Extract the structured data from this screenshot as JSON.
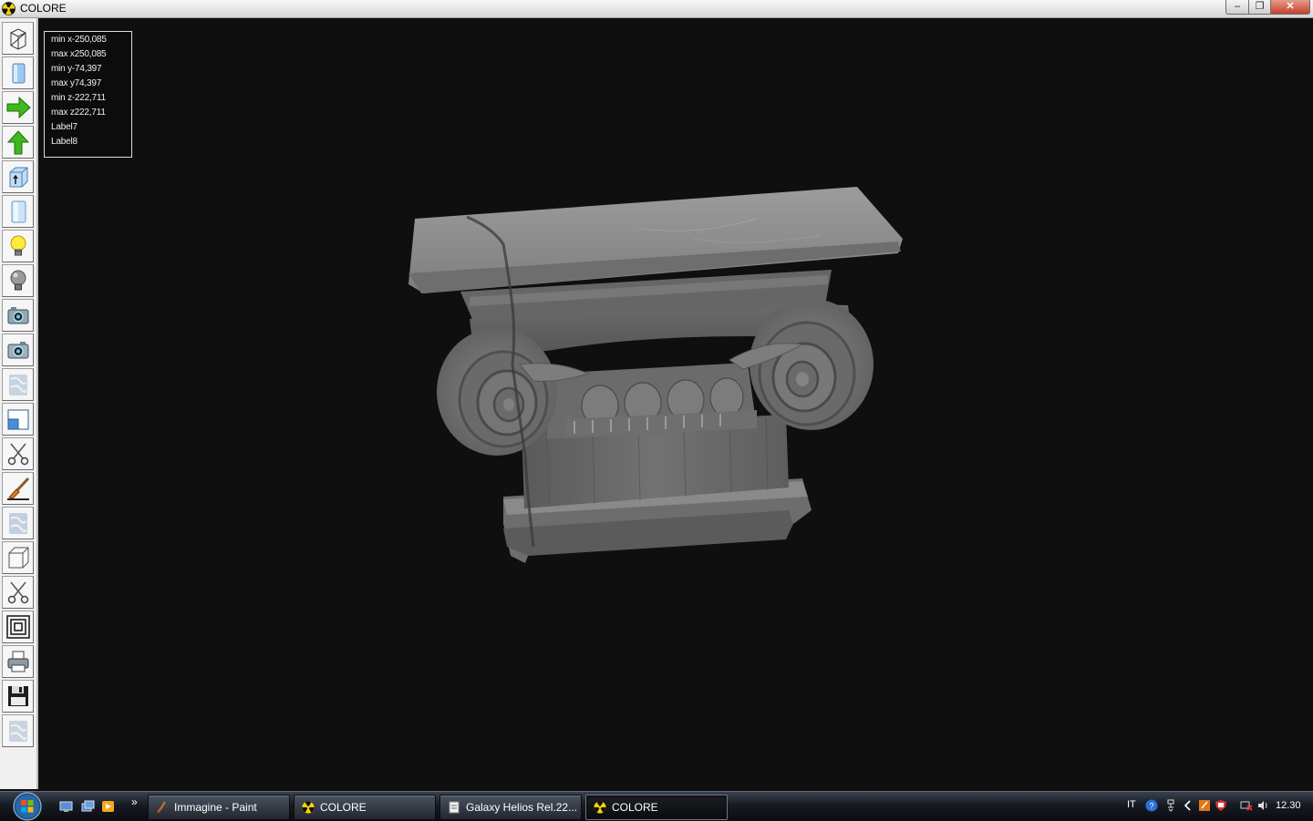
{
  "window": {
    "title": "COLORE",
    "controls": {
      "minimize": "–",
      "maximize": "❐",
      "close": "✕"
    }
  },
  "toolbar": {
    "tools": [
      {
        "icon": "wireframe-box-icon"
      },
      {
        "icon": "solid-block-icon"
      },
      {
        "icon": "arrow-right-green-icon"
      },
      {
        "icon": "arrow-up-green-icon"
      },
      {
        "icon": "extrude-up-icon"
      },
      {
        "icon": "cylinder-block-icon"
      },
      {
        "icon": "light-bulb-on-icon"
      },
      {
        "icon": "light-bulb-off-icon"
      },
      {
        "icon": "camera-icon"
      },
      {
        "icon": "camera-alt-icon"
      },
      {
        "icon": "texture-icon"
      },
      {
        "icon": "window-frame-icon"
      },
      {
        "icon": "scissors-icon"
      },
      {
        "icon": "paint-brush-icon"
      },
      {
        "icon": "texture-alt-icon"
      },
      {
        "icon": "cube-icon"
      },
      {
        "icon": "scissors-alt-icon"
      },
      {
        "icon": "concentric-squares-icon"
      },
      {
        "icon": "printer-icon"
      },
      {
        "icon": "floppy-disk-icon"
      },
      {
        "icon": "texture-disabled-icon"
      }
    ]
  },
  "info_panel": {
    "lines": [
      "min x-250,085",
      "max x250,085",
      "min y-74,397",
      "max y74,397",
      "min z-222,711",
      "max z222,711",
      "Label7",
      "Label8"
    ]
  },
  "taskbar": {
    "tasks": [
      {
        "label": "Immagine - Paint",
        "icon": "paint-icon",
        "active": false
      },
      {
        "label": "COLORE",
        "icon": "radiation-icon",
        "active": false
      },
      {
        "label": "Galaxy Helios  Rel.22...",
        "icon": "document-icon",
        "active": false
      },
      {
        "label": "COLORE",
        "icon": "radiation-icon",
        "active": true
      }
    ],
    "quick_launch_more": "»",
    "tray": {
      "language": "IT",
      "time": "12.30"
    }
  },
  "colors": {
    "viewport_bg": "#0f0f0f",
    "marble": "#8a8a8a",
    "toolbar_bg": "#f0f0f0",
    "arrow_green": "#3db81e"
  }
}
